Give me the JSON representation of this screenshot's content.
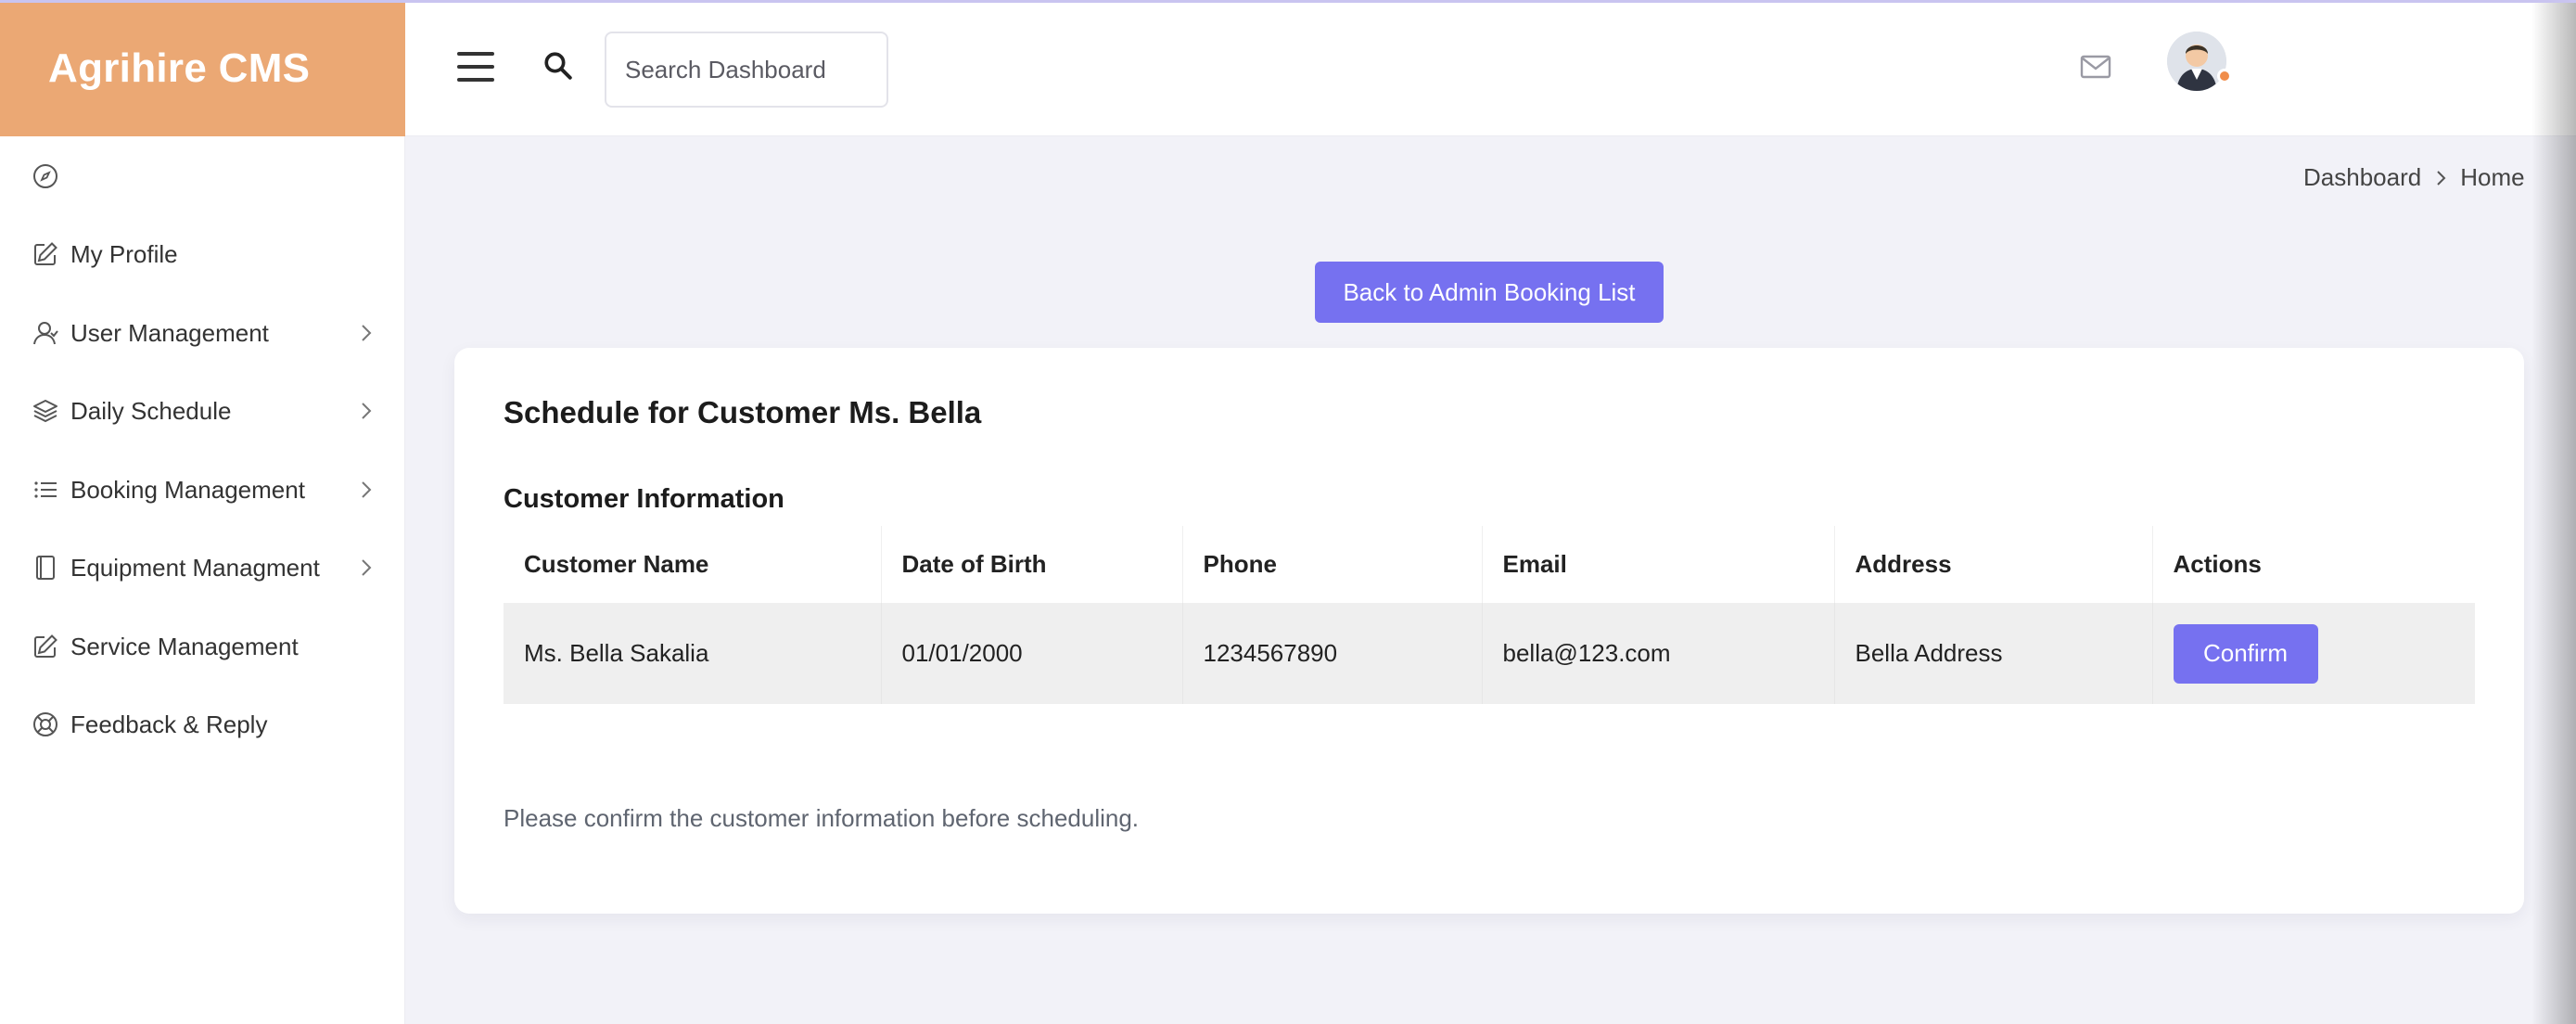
{
  "app": {
    "title": "Agrihire CMS"
  },
  "header": {
    "search_placeholder": "Search Dashboard",
    "icons": [
      "menu-icon",
      "search-icon",
      "mail-icon",
      "avatar"
    ]
  },
  "sidebar": {
    "items": [
      {
        "label": "My Profile",
        "icon": "edit-icon",
        "has_submenu": false
      },
      {
        "label": "User Management",
        "icon": "user-icon",
        "has_submenu": true
      },
      {
        "label": "Daily Schedule",
        "icon": "layers-icon",
        "has_submenu": true
      },
      {
        "label": "Booking Management",
        "icon": "list-icon",
        "has_submenu": true
      },
      {
        "label": "Equipment Managment",
        "icon": "book-icon",
        "has_submenu": true
      },
      {
        "label": "Service Management",
        "icon": "edit-icon",
        "has_submenu": false
      },
      {
        "label": "Feedback & Reply",
        "icon": "lifebuoy-icon",
        "has_submenu": false
      }
    ]
  },
  "breadcrumb": {
    "items": [
      "Dashboard",
      "Home"
    ]
  },
  "main": {
    "back_button": "Back to Admin Booking List",
    "card_title": "Schedule for Customer Ms. Bella",
    "section_title": "Customer Information",
    "table": {
      "headers": [
        "Customer Name",
        "Date of Birth",
        "Phone",
        "Email",
        "Address",
        "Actions"
      ],
      "rows": [
        {
          "name": "Ms. Bella Sakalia",
          "dob": "01/01/2000",
          "phone": "1234567890",
          "email": "bella@123.com",
          "address": "Bella Address",
          "action": "Confirm"
        }
      ]
    },
    "note": "Please confirm the customer information before scheduling."
  },
  "colors": {
    "brand": "#eba874",
    "accent": "#7671f0",
    "background": "#f2f2f8"
  }
}
